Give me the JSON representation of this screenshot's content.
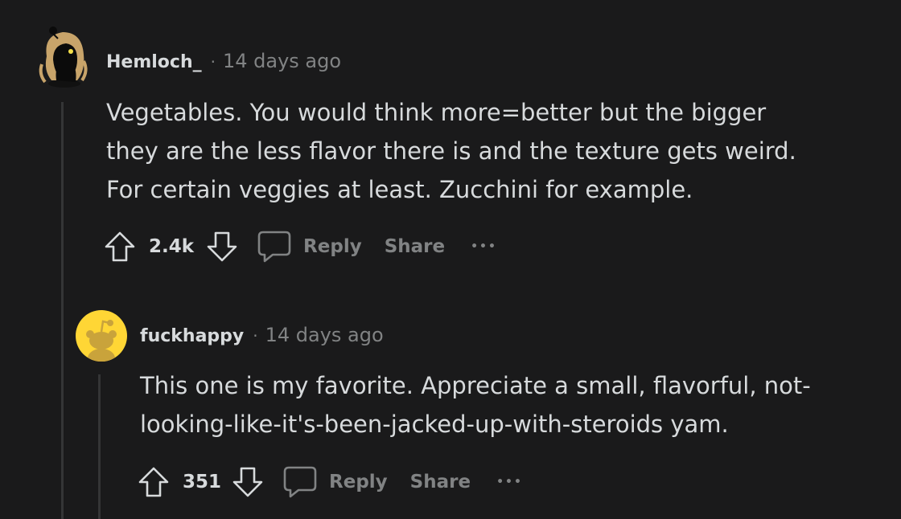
{
  "comments": [
    {
      "username": "Hemloch_",
      "separator": "·",
      "time": "14 days ago",
      "body_lines": [
        "Vegetables. You would think more=better but the bigger",
        "they are the less flavor there is and the texture gets weird.",
        "For certain veggies at least. Zucchini for example."
      ],
      "score": "2.4k",
      "reply_label": "Reply",
      "share_label": "Share",
      "more_label": "•••"
    },
    {
      "username": "fuckhappy",
      "separator": "·",
      "time": "14 days ago",
      "body_lines": [
        "This one is my favorite. Appreciate a small, flavorful, not-",
        "looking-like-it's-been-jacked-up-with-steroids yam."
      ],
      "score": "351",
      "reply_label": "Reply",
      "share_label": "Share",
      "more_label": "•••"
    }
  ],
  "colors": {
    "background": "#1a1a1b",
    "text": "#d7dadc",
    "muted": "#818384",
    "thread_line": "#343536",
    "avatar_yellow": "#ffd635"
  },
  "icons": {
    "upvote": "arrow-up-outline",
    "downvote": "arrow-down-outline",
    "reply": "speech-bubble-outline",
    "more": "ellipsis"
  }
}
